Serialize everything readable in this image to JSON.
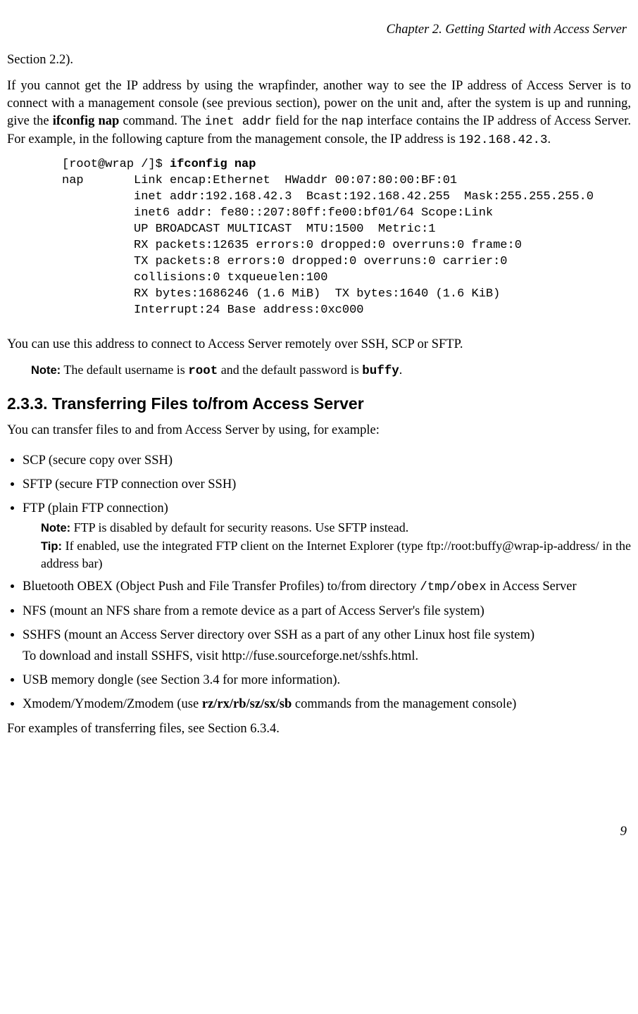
{
  "header": "Chapter 2. Getting Started with Access Server",
  "p1": "Section 2.2).",
  "p2_a": "If you cannot get the IP address by using the wrapfinder, another way to see the IP address of Access Server is to connect with a management console (see previous section), power on the unit and, after the system is up and running, give the ",
  "p2_b": "ifconfig nap",
  "p2_c": " command. The ",
  "p2_d": "inet addr",
  "p2_e": " field for the ",
  "p2_f": "nap",
  "p2_g": " interface contains the IP address of Access Server. For example, in the following capture from the management console, the IP address is ",
  "p2_h": "192.168.42.3",
  "p2_i": ".",
  "code_prompt": "[root@wrap /]$ ",
  "code_cmd": "ifconfig nap",
  "code_body": "nap       Link encap:Ethernet  HWaddr 00:07:80:00:BF:01\n          inet addr:192.168.42.3  Bcast:192.168.42.255  Mask:255.255.255.0\n          inet6 addr: fe80::207:80ff:fe00:bf01/64 Scope:Link\n          UP BROADCAST MULTICAST  MTU:1500  Metric:1\n          RX packets:12635 errors:0 dropped:0 overruns:0 frame:0\n          TX packets:8 errors:0 dropped:0 overruns:0 carrier:0\n          collisions:0 txqueuelen:100\n          RX bytes:1686246 (1.6 MiB)  TX bytes:1640 (1.6 KiB)\n          Interrupt:24 Base address:0xc000",
  "p3": "You can use this address to connect to Access Server remotely over SSH, SCP or SFTP.",
  "note1_label": "Note:",
  "note1_a": " The default username is ",
  "note1_b": "root",
  "note1_c": " and the default password is ",
  "note1_d": "buffy",
  "note1_e": ".",
  "section_heading": "2.3.3. Transferring Files to/from Access Server",
  "p4": "You can transfer files to and from Access Server by using, for example:",
  "li1": "SCP (secure copy over SSH)",
  "li2": "SFTP (secure FTP connection over SSH)",
  "li3": "FTP (plain FTP connection)",
  "li3_note_label": "Note:",
  "li3_note": " FTP is disabled by default for security reasons. Use SFTP instead.",
  "li3_tip_label": "Tip:",
  "li3_tip": " If enabled, use the integrated FTP client on the Internet Explorer (type ftp://root:buffy@wrap-ip-address/ in the address bar)",
  "li4_a": "Bluetooth OBEX (Object Push and File Transfer Profiles) to/from directory ",
  "li4_b": "/tmp/obex",
  "li4_c": " in Access Server",
  "li5": "NFS (mount an NFS share from a remote device as a part of Access Server's file system)",
  "li6": "SSHFS (mount an Access Server directory over SSH as a part of any other Linux host file system)",
  "li6_p": "To download and install SSHFS, visit http://fuse.sourceforge.net/sshfs.html.",
  "li7": "USB memory dongle (see Section 3.4 for more information).",
  "li8_a": "Xmodem/Ymodem/Zmodem (use ",
  "li8_b": "rz/rx/rb/sz/sx/sb",
  "li8_c": " commands from the management console)",
  "p5": "For examples of transferring files, see Section 6.3.4.",
  "page_number": "9"
}
